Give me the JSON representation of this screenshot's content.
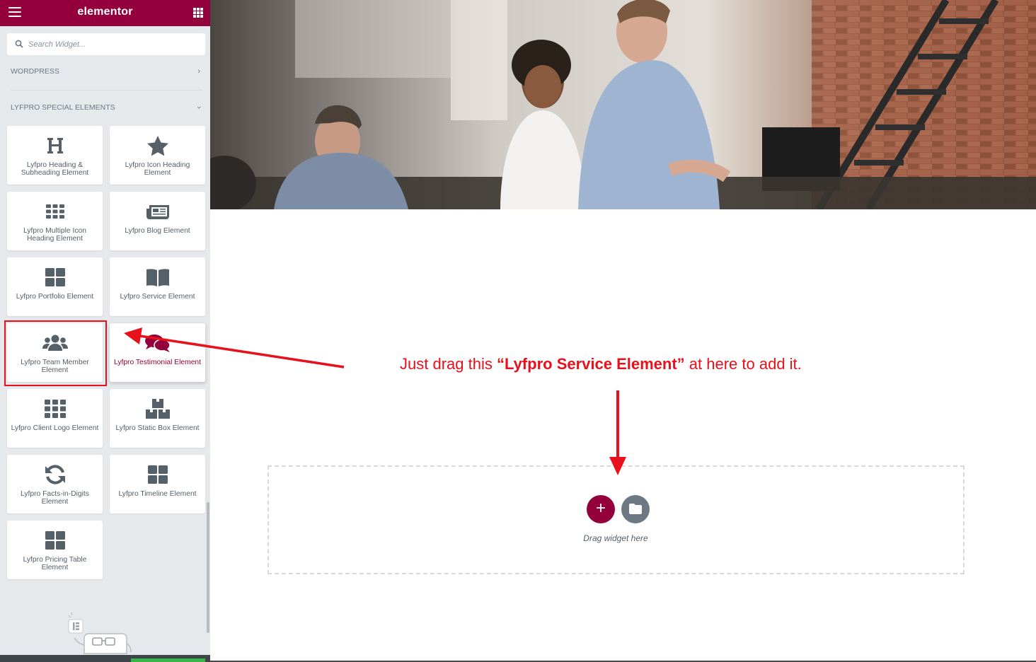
{
  "app": {
    "logo_text": "elementor"
  },
  "search": {
    "placeholder": "Search Widget..."
  },
  "categories": {
    "wordpress": "WORDPRESS",
    "special": "LYFPRO SPECIAL ELEMENTS"
  },
  "widgets": [
    {
      "label": "Lyfpro Heading & Subheading Element",
      "icon": "heading-icon"
    },
    {
      "label": "Lyfpro Icon Heading Element",
      "icon": "star-icon"
    },
    {
      "label": "Lyfpro Multiple Icon Heading Element",
      "icon": "grid-icon"
    },
    {
      "label": "Lyfpro Blog Element",
      "icon": "newspaper-icon"
    },
    {
      "label": "Lyfpro Portfolio Element",
      "icon": "th-large-icon"
    },
    {
      "label": "Lyfpro Service Element",
      "icon": "book-open-icon"
    },
    {
      "label": "Lyfpro Team Member Element",
      "icon": "users-icon"
    },
    {
      "label": "Lyfpro Testimonial Element",
      "icon": "comments-icon"
    },
    {
      "label": "Lyfpro Client Logo Element",
      "icon": "grid-icon"
    },
    {
      "label": "Lyfpro Static Box Element",
      "icon": "boxes-icon"
    },
    {
      "label": "Lyfpro Facts-in-Digits Element",
      "icon": "sync-icon"
    },
    {
      "label": "Lyfpro Timeline Element",
      "icon": "th-large-icon"
    },
    {
      "label": "Lyfpro Pricing Table Element",
      "icon": "th-large-icon"
    }
  ],
  "canvas": {
    "instruction_pre": "Just drag this ",
    "instruction_bold": "“Lyfpro Service Element”",
    "instruction_post": " at here to add it.",
    "drop_text": "Drag widget here",
    "add_symbol": "+"
  },
  "colors": {
    "brand": "#93003c",
    "annotation": "#e8101a",
    "sidebar_bg": "#e6e9ec"
  }
}
